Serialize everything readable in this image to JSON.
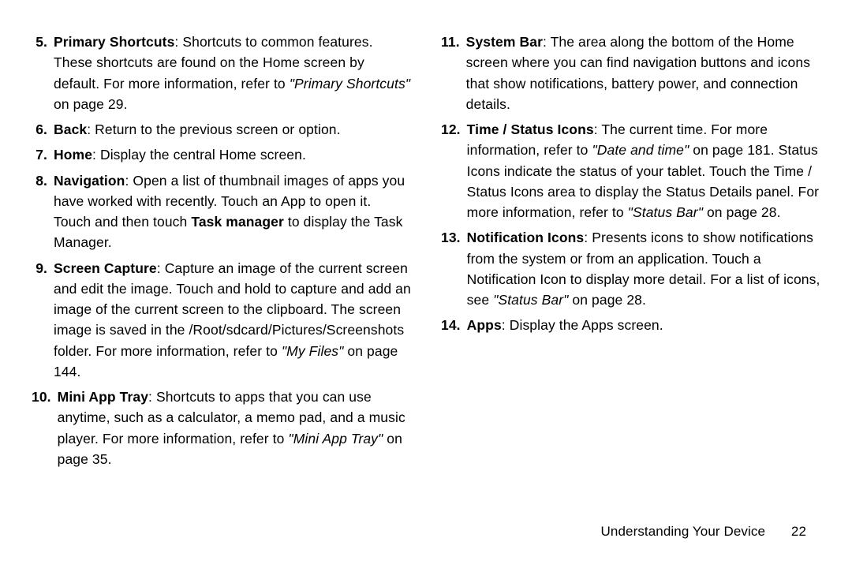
{
  "left": [
    {
      "num": "5.",
      "title": "Primary Shortcuts",
      "text": ": Shortcuts to common features. These shortcuts are found on the Home screen by default. For more information, refer to ",
      "ref": "\"Primary Shortcuts\"",
      "tail": "  on page 29."
    },
    {
      "num": "6.",
      "title": "Back",
      "text": ": Return to the previous screen or option.",
      "ref": "",
      "tail": ""
    },
    {
      "num": "7.",
      "title": "Home",
      "text": ": Display the central Home screen.",
      "ref": "",
      "tail": ""
    },
    {
      "num": "8.",
      "title": "Navigation",
      "text": ": Open a list of thumbnail images of apps you have worked with recently. Touch an App to open it. Touch and then touch ",
      "bold2": "Task manager",
      "text2": " to display the Task Manager.",
      "ref": "",
      "tail": ""
    },
    {
      "num": "9.",
      "title": "Screen Capture",
      "text": ": Capture an image of the current screen and edit the image. Touch and hold to capture and add an image of the current screen to the clipboard. The screen image is saved in the /Root/sdcard/Pictures/Screenshots folder. For more information, refer to ",
      "ref": "\"My Files\"",
      "tail": "  on page 144."
    },
    {
      "num": "10.",
      "title": "Mini App Tray",
      "text": ": Shortcuts to apps that you can use anytime, such as a calculator, a memo pad, and a music player. For more information, refer to ",
      "ref": "\"Mini App Tray\"",
      "tail": "  on page 35."
    }
  ],
  "right": [
    {
      "num": "11.",
      "title": "System Bar",
      "text": ": The area along the bottom of the Home screen where you can find navigation buttons and icons that show notifications, battery power, and connection details.",
      "ref": "",
      "tail": ""
    },
    {
      "num": "12.",
      "title": "Time / Status Icons",
      "text": ": The current time. For more information, refer to ",
      "ref": "\"Date and time\"",
      "tail": "  on page 181. Status Icons indicate the status of your tablet. Touch the Time / Status Icons area to display the Status Details panel. For more information, refer to ",
      "ref2": "\"Status Bar\"",
      "tail2": "  on page 28."
    },
    {
      "num": "13.",
      "title": "Notification Icons",
      "text": ": Presents icons to show notifications from the system or from an application. Touch a Notification Icon to display more detail. For a list of icons, see ",
      "ref": "\"Status Bar\"",
      "tail": " on page 28."
    },
    {
      "num": "14.",
      "title": "Apps",
      "text": ": Display the Apps screen.",
      "ref": "",
      "tail": ""
    }
  ],
  "footer": {
    "section": "Understanding Your Device",
    "page": "22"
  }
}
